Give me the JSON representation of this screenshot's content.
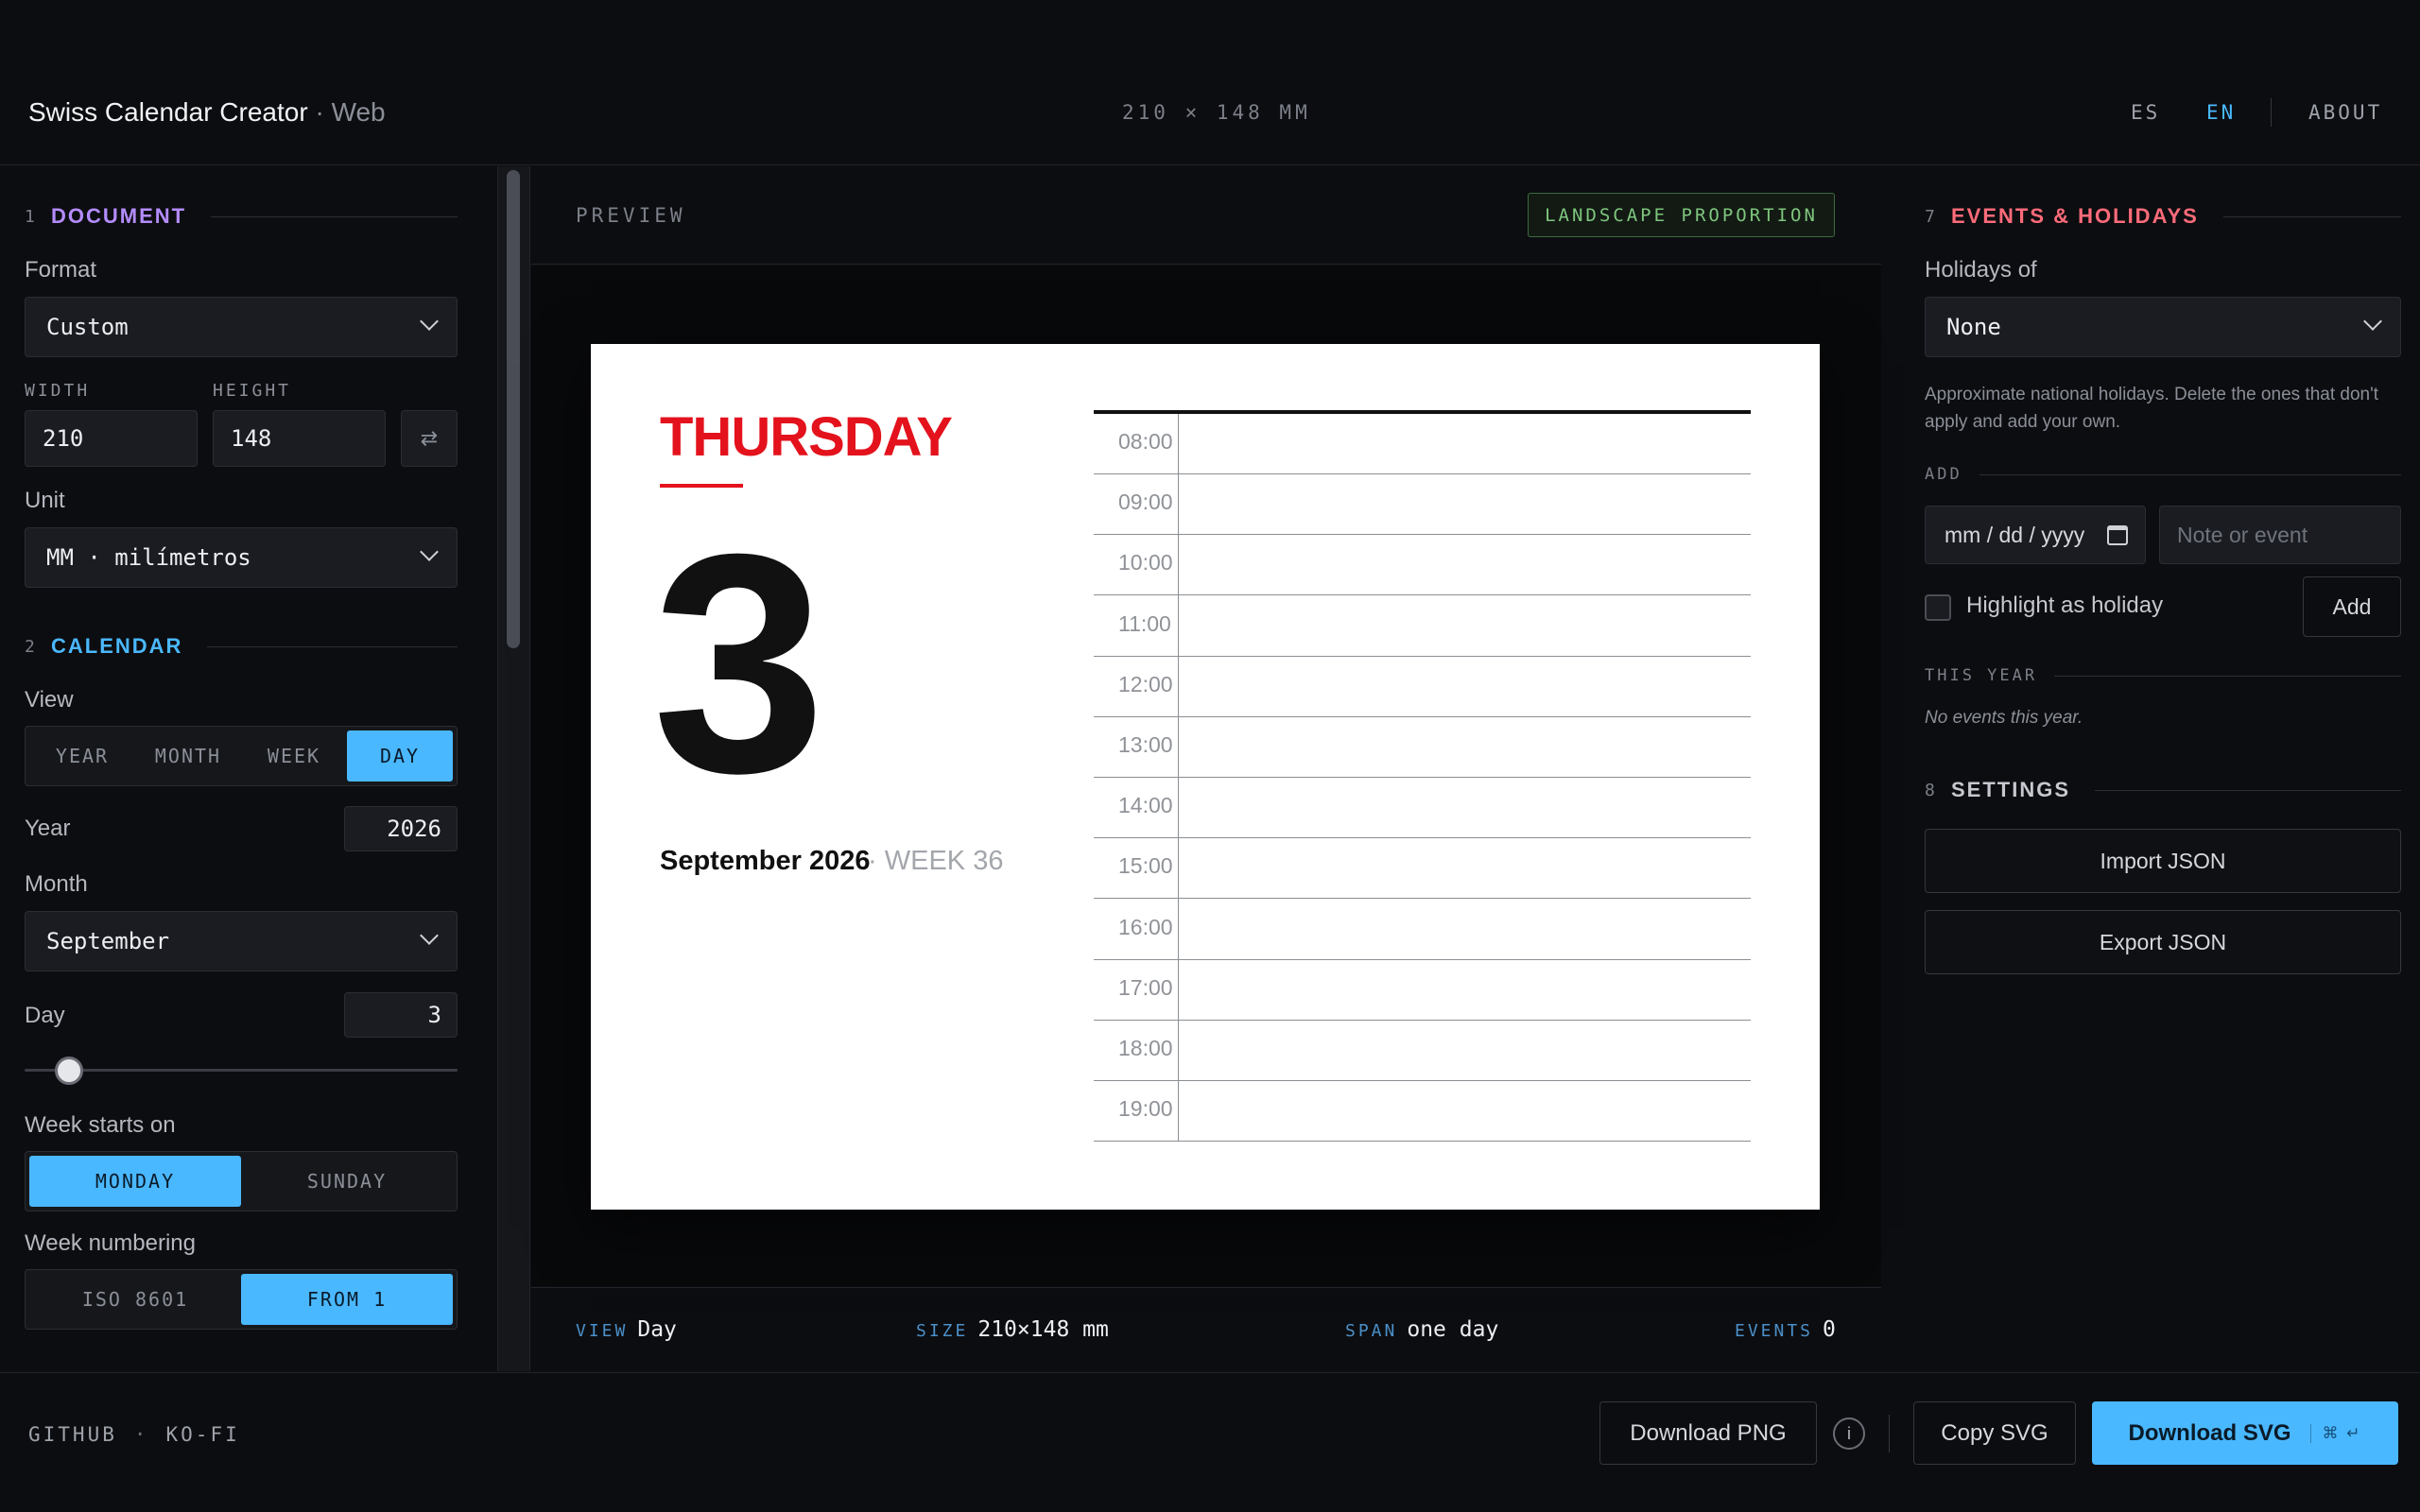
{
  "header": {
    "app_name": "Swiss Calendar Creator",
    "separator": "·",
    "app_sub": "Web",
    "dimensions": "210 × 148 MM",
    "lang_es": "ES",
    "lang_en": "EN",
    "about": "ABOUT"
  },
  "document": {
    "num": "1",
    "title": "DOCUMENT",
    "title_color": "#b48cff",
    "format_label": "Format",
    "format_value": "Custom",
    "width_label": "WIDTH",
    "width_value": "210",
    "height_label": "HEIGHT",
    "height_value": "148",
    "swap_icon": "⇄",
    "unit_label": "Unit",
    "unit_value": "MM · milímetros"
  },
  "calendar": {
    "num": "2",
    "title": "CALENDAR",
    "title_color": "#4ab8ff",
    "view_label": "View",
    "views": [
      "YEAR",
      "MONTH",
      "WEEK",
      "DAY"
    ],
    "active_view": "DAY",
    "year_label": "Year",
    "year_value": "2026",
    "month_label": "Month",
    "month_value": "September",
    "day_label": "Day",
    "day_value": "3",
    "day_slider_fraction": 0.07,
    "week_start_label": "Week starts on",
    "week_start_options": [
      "MONDAY",
      "SUNDAY"
    ],
    "week_start_active": "MONDAY",
    "week_num_label": "Week numbering",
    "week_num_options": [
      "ISO 8601",
      "FROM 1"
    ],
    "week_num_active": "FROM 1"
  },
  "preview": {
    "label": "PREVIEW",
    "badge": "LANDSCAPE PROPORTION",
    "day_name": "THURSDAY",
    "day_number": "3",
    "month_year": "September 2026",
    "dot": "·",
    "week": "WEEK 36",
    "times": [
      "08:00",
      "09:00",
      "10:00",
      "11:00",
      "12:00",
      "13:00",
      "14:00",
      "15:00",
      "16:00",
      "17:00",
      "18:00",
      "19:00"
    ]
  },
  "stats": {
    "view_k": "VIEW",
    "view_v": "Day",
    "size_k": "SIZE",
    "size_v": "210×148 mm",
    "span_k": "SPAN",
    "span_v": "one day",
    "events_k": "EVENTS",
    "events_v": "0"
  },
  "events": {
    "num": "7",
    "title": "EVENTS & HOLIDAYS",
    "title_color": "#ff6b7a",
    "holidays_label": "Holidays of",
    "holidays_value": "None",
    "description": "Approximate national holidays. Delete the ones that don't apply and add your own.",
    "add_label": "ADD",
    "date_placeholder": "mm / dd / yyyy",
    "note_placeholder": "Note or event",
    "highlight_label": "Highlight as holiday",
    "add_button": "Add",
    "this_year_label": "THIS YEAR",
    "empty_note": "No events this year."
  },
  "settings": {
    "num": "8",
    "title": "SETTINGS",
    "import": "Import JSON",
    "export": "Export JSON"
  },
  "footer": {
    "github": "GITHUB",
    "dot": "·",
    "kofi": "KO-FI",
    "download_png": "Download PNG",
    "info": "i",
    "copy_svg": "Copy SVG",
    "download_svg": "Download SVG",
    "shortcut": "⌘ ↵"
  }
}
